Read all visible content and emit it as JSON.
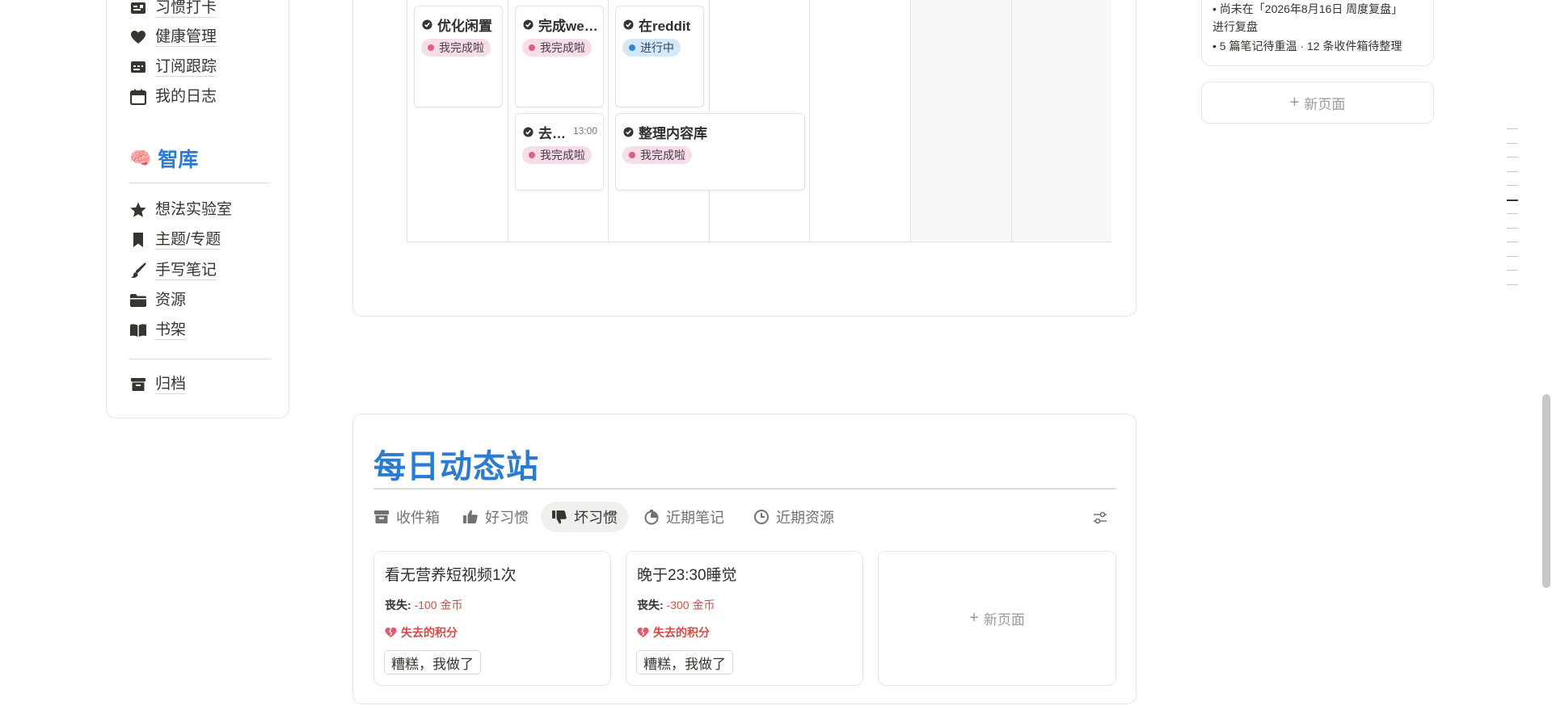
{
  "sidebar": {
    "items_top": [
      {
        "label": "习惯打卡",
        "icon": "habit-card-icon"
      },
      {
        "label": "健康管理",
        "icon": "heart-icon"
      },
      {
        "label": "订阅跟踪",
        "icon": "subscription-icon"
      },
      {
        "label": "我的日志",
        "icon": "calendar-icon"
      }
    ],
    "section_title": "智库",
    "section_emoji": "🧠",
    "items_mid": [
      {
        "label": "想法实验室",
        "icon": "star-icon"
      },
      {
        "label": "主题/专题",
        "icon": "bookmark-icon"
      },
      {
        "label": "手写笔记",
        "icon": "brush-icon"
      },
      {
        "label": "资源",
        "icon": "folder-icon"
      },
      {
        "label": "书架",
        "icon": "book-icon"
      }
    ],
    "items_bottom": [
      {
        "label": "归档",
        "icon": "archive-icon"
      }
    ]
  },
  "calendar": {
    "events": [
      {
        "title": "优化闲置",
        "status": "我完成啦"
      },
      {
        "title": "完成week",
        "status": "我完成啦"
      },
      {
        "title": "在reddit",
        "status": "进行中"
      },
      {
        "title": "去跑步",
        "time": "13:00",
        "status": "我完成啦"
      },
      {
        "title": "整理内容库",
        "status": "我完成啦"
      }
    ]
  },
  "info": {
    "line1": "• 尚未在「2026年8月16日 周度复盘」",
    "line2": "进行复盘",
    "line3": "• 5 篇笔记待重温 · 12 条收件箱待整理",
    "new_page": "新页面"
  },
  "daily": {
    "title": "每日动态站",
    "tabs": [
      {
        "label": "收件箱",
        "icon": "inbox-icon"
      },
      {
        "label": "好习惯",
        "icon": "thumbs-up-icon"
      },
      {
        "label": "坏习惯",
        "icon": "thumbs-down-icon"
      },
      {
        "label": "近期笔记",
        "icon": "timer-icon"
      },
      {
        "label": "近期资源",
        "icon": "clock-icon"
      }
    ],
    "cards": [
      {
        "title": "看无营养短视频1次",
        "loss_label": "丧失:",
        "loss_value": "-100 金币",
        "points": "失去的积分",
        "action": "糟糕，我做了"
      },
      {
        "title": "晚于23:30睡觉",
        "loss_label": "丧失:",
        "loss_value": "-300 金币",
        "points": "失去的积分",
        "action": "糟糕，我做了"
      }
    ],
    "new_page": "新页面"
  },
  "colors": {
    "accent": "#2b7bd0",
    "done_tag": "#f6dde7",
    "progress_tag": "#d6e8f7",
    "loss": "#d44c47"
  }
}
